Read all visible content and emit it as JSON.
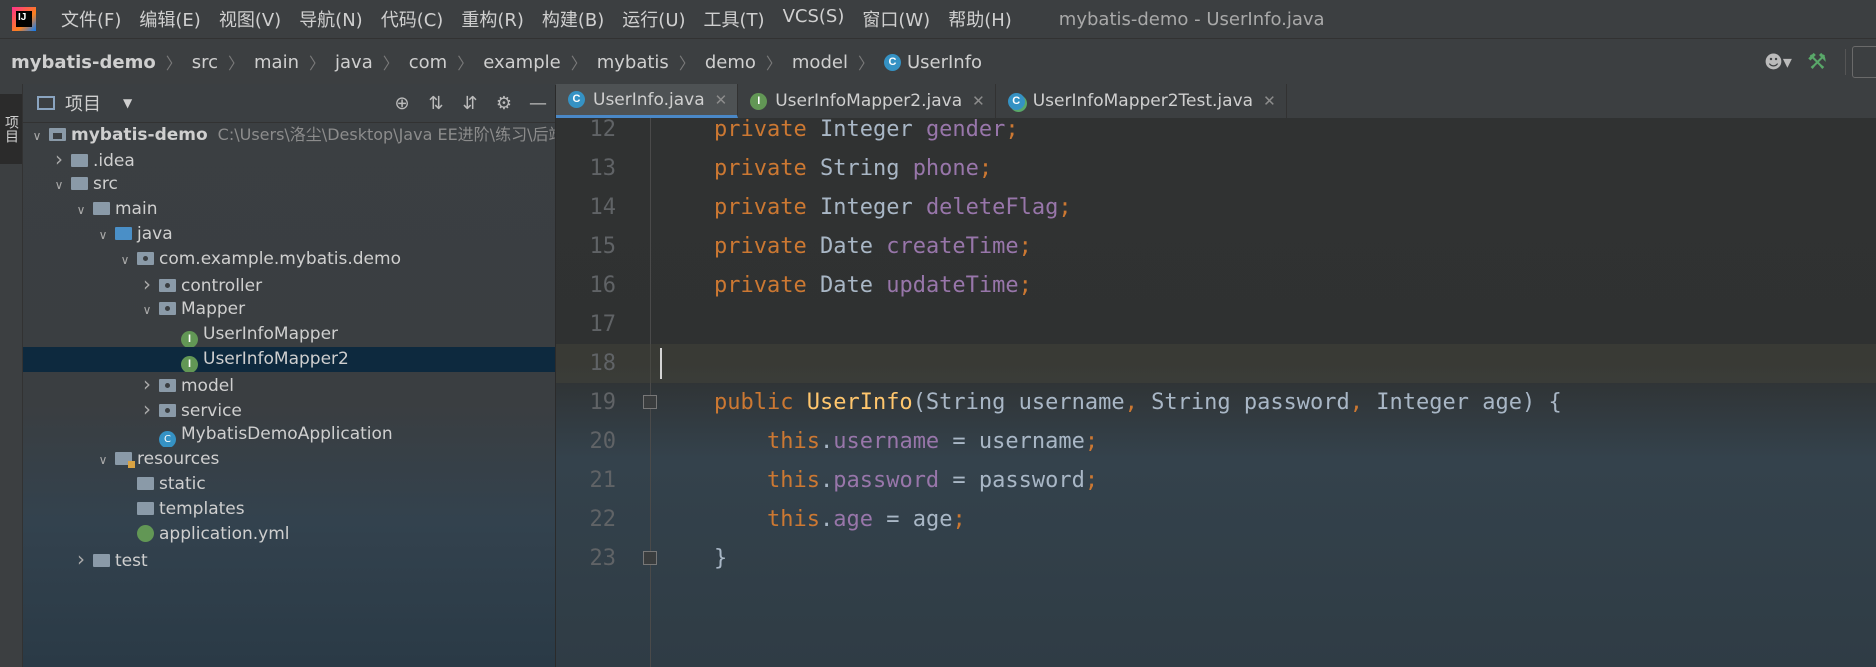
{
  "app": {
    "logo_text": "IJ",
    "window_title": "mybatis-demo - UserInfo.java"
  },
  "menu": [
    "文件(F)",
    "编辑(E)",
    "视图(V)",
    "导航(N)",
    "代码(C)",
    "重构(R)",
    "构建(B)",
    "运行(U)",
    "工具(T)",
    "VCS(S)",
    "窗口(W)",
    "帮助(H)"
  ],
  "breadcrumb": [
    "mybatis-demo",
    "src",
    "main",
    "java",
    "com",
    "example",
    "mybatis",
    "demo",
    "model",
    "UserInfo"
  ],
  "toolbar": {
    "user_icon": "user-icon",
    "build_icon": "hammer-icon"
  },
  "tool_stripe": {
    "project_label": "项目"
  },
  "project_panel": {
    "title": "项目",
    "tools": [
      "locate-icon",
      "expand-all-icon",
      "collapse-all-icon",
      "settings-icon",
      "hide-icon"
    ]
  },
  "tree": [
    {
      "label": "mybatis-demo",
      "path": "C:\\Users\\洛尘\\Desktop\\Java EE进阶\\练习\\后端代码\\r",
      "depth": 0,
      "arrow": "down",
      "icon": "module-folder"
    },
    {
      "label": ".idea",
      "depth": 1,
      "arrow": "right",
      "icon": "folder"
    },
    {
      "label": "src",
      "depth": 1,
      "arrow": "down",
      "icon": "folder"
    },
    {
      "label": "main",
      "depth": 2,
      "arrow": "down",
      "icon": "folder"
    },
    {
      "label": "java",
      "depth": 3,
      "arrow": "down",
      "icon": "source-folder"
    },
    {
      "label": "com.example.mybatis.demo",
      "depth": 4,
      "arrow": "down",
      "icon": "package"
    },
    {
      "label": "controller",
      "depth": 5,
      "arrow": "right",
      "icon": "package"
    },
    {
      "label": "Mapper",
      "depth": 5,
      "arrow": "down",
      "icon": "package"
    },
    {
      "label": "UserInfoMapper",
      "depth": 6,
      "arrow": "none",
      "icon": "interface"
    },
    {
      "label": "UserInfoMapper2",
      "depth": 6,
      "arrow": "none",
      "icon": "interface",
      "selected": true
    },
    {
      "label": "model",
      "depth": 5,
      "arrow": "right",
      "icon": "package"
    },
    {
      "label": "service",
      "depth": 5,
      "arrow": "right",
      "icon": "package"
    },
    {
      "label": "MybatisDemoApplication",
      "depth": 5,
      "arrow": "none",
      "icon": "spring-app"
    },
    {
      "label": "resources",
      "depth": 3,
      "arrow": "down",
      "icon": "resources-folder"
    },
    {
      "label": "static",
      "depth": 4,
      "arrow": "none",
      "icon": "folder"
    },
    {
      "label": "templates",
      "depth": 4,
      "arrow": "none",
      "icon": "folder"
    },
    {
      "label": "application.yml",
      "depth": 4,
      "arrow": "none",
      "icon": "yml"
    },
    {
      "label": "test",
      "depth": 2,
      "arrow": "right",
      "icon": "folder"
    }
  ],
  "tabs": [
    {
      "label": "UserInfo.java",
      "icon": "class",
      "active": true
    },
    {
      "label": "UserInfoMapper2.java",
      "icon": "interface",
      "active": false
    },
    {
      "label": "UserInfoMapper2Test.java",
      "icon": "test-class",
      "active": false
    }
  ],
  "code": [
    {
      "n": "12",
      "tokens": [
        [
          "kw",
          "private "
        ],
        [
          "ty",
          "Integer "
        ],
        [
          "fd",
          "gender"
        ],
        [
          "kw",
          ";"
        ]
      ]
    },
    {
      "n": "13",
      "tokens": [
        [
          "kw",
          "private "
        ],
        [
          "ty",
          "String "
        ],
        [
          "fd",
          "phone"
        ],
        [
          "kw",
          ";"
        ]
      ]
    },
    {
      "n": "14",
      "tokens": [
        [
          "kw",
          "private "
        ],
        [
          "ty",
          "Integer "
        ],
        [
          "fd",
          "deleteFlag"
        ],
        [
          "kw",
          ";"
        ]
      ]
    },
    {
      "n": "15",
      "tokens": [
        [
          "kw",
          "private "
        ],
        [
          "ty",
          "Date "
        ],
        [
          "fd",
          "createTime"
        ],
        [
          "kw",
          ";"
        ]
      ]
    },
    {
      "n": "16",
      "tokens": [
        [
          "kw",
          "private "
        ],
        [
          "ty",
          "Date "
        ],
        [
          "fd",
          "updateTime"
        ],
        [
          "kw",
          ";"
        ]
      ]
    },
    {
      "n": "17",
      "tokens": []
    },
    {
      "n": "18",
      "tokens": [],
      "current": true
    },
    {
      "n": "19",
      "tokens": [
        [
          "kw",
          "public "
        ],
        [
          "fn",
          "UserInfo"
        ],
        [
          "pl",
          "(String username"
        ],
        [
          "kw",
          ", "
        ],
        [
          "pl",
          "String password"
        ],
        [
          "kw",
          ", "
        ],
        [
          "pl",
          "Integer age) {"
        ]
      ],
      "fold": true
    },
    {
      "n": "20",
      "tokens": [
        [
          "pl",
          "    "
        ],
        [
          "kw",
          "this"
        ],
        [
          "pl",
          "."
        ],
        [
          "fd",
          "username"
        ],
        [
          "pl",
          " = username"
        ],
        [
          "kw",
          ";"
        ]
      ]
    },
    {
      "n": "21",
      "tokens": [
        [
          "pl",
          "    "
        ],
        [
          "kw",
          "this"
        ],
        [
          "pl",
          "."
        ],
        [
          "fd",
          "password"
        ],
        [
          "pl",
          " = password"
        ],
        [
          "kw",
          ";"
        ]
      ]
    },
    {
      "n": "22",
      "tokens": [
        [
          "pl",
          "    "
        ],
        [
          "kw",
          "this"
        ],
        [
          "pl",
          "."
        ],
        [
          "fd",
          "age"
        ],
        [
          "pl",
          " = age"
        ],
        [
          "kw",
          ";"
        ]
      ]
    },
    {
      "n": "23",
      "tokens": [
        [
          "pl",
          "}"
        ]
      ],
      "fold": true
    }
  ]
}
